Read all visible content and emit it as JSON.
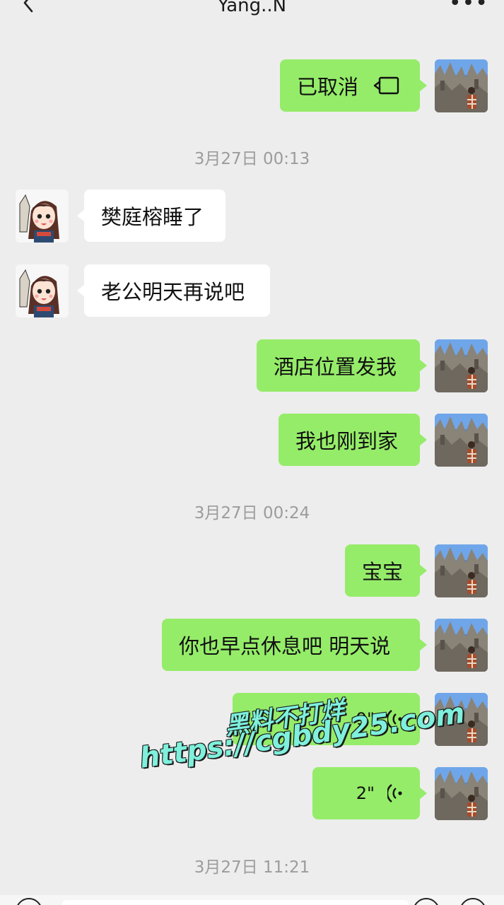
{
  "header": {
    "title": "Yang..N"
  },
  "messages": [
    {
      "sender": "me",
      "text": "已取消"
    },
    {
      "sender": "system",
      "text": "3月27日 00:13"
    },
    {
      "sender": "contact",
      "text": "樊庭榕睡了"
    },
    {
      "sender": "contact",
      "text": "老公明天再说吧"
    },
    {
      "sender": "me",
      "text": "酒店位置发我"
    },
    {
      "sender": "me",
      "text": "我也刚到家"
    },
    {
      "sender": "system",
      "text": "3月27日 00:24"
    },
    {
      "sender": "me",
      "text": "宝宝"
    },
    {
      "sender": "me",
      "text": "你也早点休息吧 明天说"
    },
    {
      "sender": "me",
      "text": "9\""
    },
    {
      "sender": "me",
      "text": "2\""
    },
    {
      "sender": "system",
      "text": "3月27日 11:21"
    }
  ],
  "watermark": {
    "line1": "黑料不打烊",
    "line2": "https://cgbdy25.com"
  },
  "icons": {
    "back": "chevron-left-icon",
    "more": "more-dots-icon",
    "call": "video-call-icon",
    "voice": "voice-wave-icon"
  },
  "colors": {
    "background": "#ededed",
    "my_bubble": "#95ec69",
    "their_bubble": "#ffffff",
    "timestamp": "#9c9c9c"
  }
}
